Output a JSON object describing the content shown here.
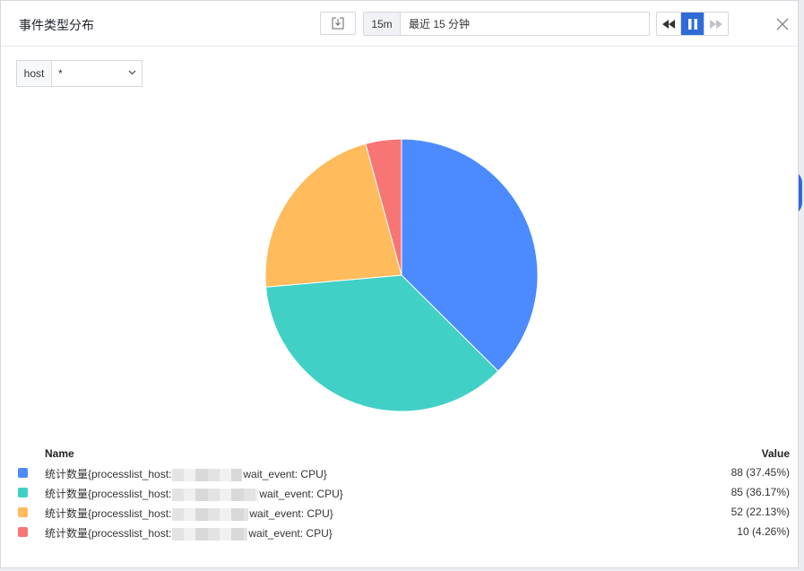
{
  "dialog": {
    "title": "事件类型分布"
  },
  "toolbar": {
    "time_short": "15m",
    "time_range": "最近 15 分钟"
  },
  "filter": {
    "key": "host",
    "value": "*"
  },
  "legend": {
    "name_header": "Name",
    "value_header": "Value",
    "rows": [
      {
        "name_prefix": "统计数量{processlist_host:",
        "name_suffix": "wait_event: CPU}",
        "value": "88 (37.45%)",
        "color": "#4b8bff"
      },
      {
        "name_prefix": "统计数量{processlist_host:",
        "name_suffix": "wait_event: CPU}",
        "value": "85 (36.17%)",
        "color": "#40d0c6"
      },
      {
        "name_prefix": "统计数量{processlist_host:",
        "name_suffix": "wait_event: CPU}",
        "value": "52 (22.13%)",
        "color": "#ffbb5c"
      },
      {
        "name_prefix": "统计数量{processlist_host:",
        "name_suffix": "wait_event: CPU}",
        "value": "10 (4.26%)",
        "color": "#f87575"
      }
    ]
  },
  "chart_data": {
    "type": "pie",
    "values": [
      88,
      85,
      52,
      10
    ],
    "colors": [
      "#4b8bff",
      "#40d0c6",
      "#ffbb5c",
      "#f87575"
    ]
  },
  "icons": {
    "download": "download-icon",
    "rewind": "rewind-icon",
    "pause": "pause-icon",
    "forward": "fast-forward-icon",
    "close": "close-icon",
    "chevron": "chevron-down-icon"
  }
}
